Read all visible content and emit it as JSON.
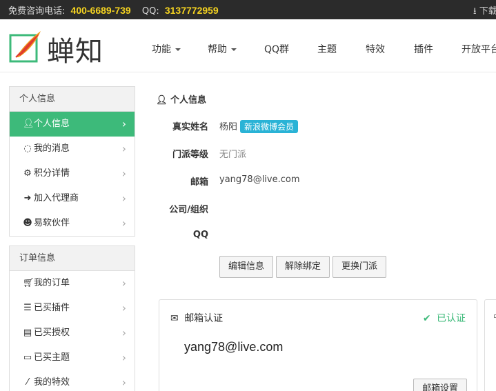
{
  "topbar": {
    "phone_label": "免费咨询电话:",
    "phone": "400-6689-739",
    "qq_label": "QQ:",
    "qq": "3137772959",
    "download_label": "下载"
  },
  "header": {
    "logo_text": "蝉知",
    "nav": [
      {
        "label": "功能",
        "dropdown": true
      },
      {
        "label": "帮助",
        "dropdown": true
      },
      {
        "label": "QQ群",
        "dropdown": false
      },
      {
        "label": "主题",
        "dropdown": false
      },
      {
        "label": "特效",
        "dropdown": false
      },
      {
        "label": "插件",
        "dropdown": false
      },
      {
        "label": "开放平台",
        "dropdown": false
      }
    ]
  },
  "sidebar": {
    "personal": {
      "title": "个人信息",
      "items": [
        {
          "label": "个人信息",
          "icon": "user-icon",
          "active": true
        },
        {
          "label": "我的消息",
          "icon": "comments-icon",
          "active": false
        },
        {
          "label": "积分详情",
          "icon": "gear-icon",
          "active": false
        },
        {
          "label": "加入代理商",
          "icon": "sign-in-icon",
          "active": false
        },
        {
          "label": "易软伙伴",
          "icon": "group-icon",
          "active": false
        }
      ]
    },
    "orders": {
      "title": "订单信息",
      "items": [
        {
          "label": "我的订单",
          "icon": "cart-icon"
        },
        {
          "label": "已买插件",
          "icon": "list-icon"
        },
        {
          "label": "已买授权",
          "icon": "license-icon"
        },
        {
          "label": "已买主题",
          "icon": "inbox-icon"
        },
        {
          "label": "我的特效",
          "icon": "magic-icon"
        }
      ]
    }
  },
  "profile": {
    "title": "个人信息",
    "real_name_label": "真实姓名",
    "real_name": "杨阳",
    "member_badge": "新浪微博会员",
    "sect_label": "门派等级",
    "sect": "无门派",
    "email_label": "邮箱",
    "email": "yang78@live.com",
    "company_label": "公司/组织",
    "company": "",
    "qq_label": "QQ",
    "qq": "",
    "buttons": {
      "edit": "编辑信息",
      "unbind": "解除绑定",
      "change_sect": "更换门派"
    }
  },
  "email_card": {
    "title": "邮箱认证",
    "status": "已认证",
    "email": "yang78@live.com",
    "button": "邮箱设置"
  },
  "colors": {
    "accent_green": "#3dba7a",
    "badge_blue": "#2ab3d6",
    "topbar_bg": "#2b2b2b",
    "highlight_yellow": "#f5d320"
  }
}
